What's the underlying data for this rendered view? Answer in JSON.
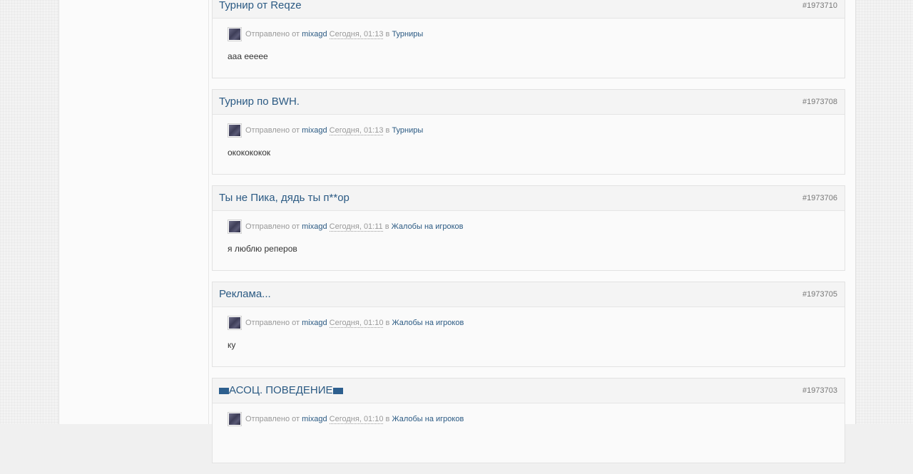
{
  "results": [
    {
      "title": "Турнир от Reqze",
      "id": "#1973710",
      "posted_by_label": "Отправлено от",
      "author": "mixagd",
      "date": "Сегодня, 01:13",
      "in_label": "в",
      "forum": "Турниры",
      "snippet": "ааа ееееe"
    },
    {
      "title": "Турнир по BWH.",
      "id": "#1973708",
      "posted_by_label": "Отправлено от",
      "author": "mixagd",
      "date": "Сегодня, 01:13",
      "in_label": "в",
      "forum": "Турниры",
      "snippet": "ококококок"
    },
    {
      "title": "Ты не Пика, дядь ты п**ор",
      "id": "#1973706",
      "posted_by_label": "Отправлено от",
      "author": "mixagd",
      "date": "Сегодня, 01:11",
      "in_label": "в",
      "forum": "Жалобы на игроков",
      "snippet": "я люблю реперов"
    },
    {
      "title": "Реклама...",
      "id": "#1973705",
      "posted_by_label": "Отправлено от",
      "author": "mixagd",
      "date": "Сегодня, 01:10",
      "in_label": "в",
      "forum": "Жалобы на игроков",
      "snippet": "ку"
    },
    {
      "title": "АСОЦ. ПОВЕДЕНИЕ",
      "title_flags": true,
      "id": "#1973703",
      "posted_by_label": "Отправлено от",
      "author": "mixagd",
      "date": "Сегодня, 01:10",
      "in_label": "в",
      "forum": "Жалобы на игроков",
      "snippet": ""
    }
  ],
  "colors": {
    "link": "#2b5a83",
    "muted": "#999999",
    "id_text": "#777777"
  }
}
